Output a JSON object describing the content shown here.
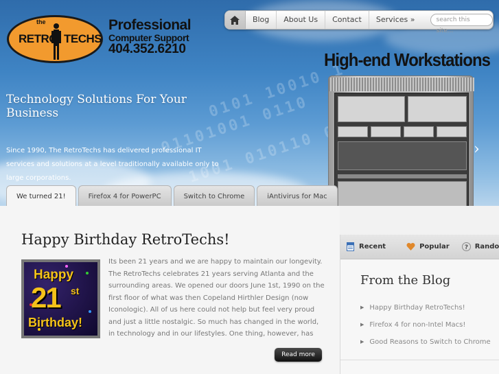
{
  "logo": {
    "the": "the",
    "retro": "RETRO",
    "techs": "TECHS",
    "line1": "Professional",
    "line2": "Computer Support",
    "phone": "404.352.6210"
  },
  "nav": {
    "home_icon": "home-icon",
    "items": [
      "Blog",
      "About Us",
      "Contact",
      "Services »"
    ],
    "search_placeholder": "search this site..."
  },
  "hero": {
    "title": "Technology Solutions For Your Business",
    "description": "Since 1990, The RetroTechs has delivered professional IT services and solutions at a level traditionally available only to large corporations.",
    "feature_title": "High-end Workstations",
    "next_icon": "chevron-right-icon"
  },
  "tabs": [
    {
      "label": "We turned 21!",
      "active": true
    },
    {
      "label": "Firefox 4 for PowerPC",
      "active": false
    },
    {
      "label": "Switch to Chrome",
      "active": false
    },
    {
      "label": "iAntivirus for Mac",
      "active": false
    }
  ],
  "post": {
    "title": "Happy Birthday RetroTechs!",
    "image_text": {
      "happy": "Happy",
      "num": "21",
      "st": "st",
      "birthday": "Birthday!"
    },
    "body": "Its been 21 years and we are happy to maintain our longevity. The RetroTechs celebrates 21 years serving Atlanta and the surrounding areas. We opened our doors June 1st, 1990 on the first floor of what was then Copeland Hirthler Design (now Iconologic). All of us here could not help but feel very proud and just a little nostalgic. So much has changed in the world, in technology and in our lifestyles. One thing, however, has remained the same:...",
    "read_more": "Read more"
  },
  "sidebar": {
    "tabs": [
      {
        "label": "Recent",
        "icon": "document-icon",
        "color": "#3a6fb6"
      },
      {
        "label": "Popular",
        "icon": "heart-icon",
        "color": "#e0882b"
      },
      {
        "label": "Random",
        "icon": "question-icon",
        "color": "#8a8a8a"
      }
    ],
    "heading": "From the Blog",
    "items": [
      "Happy Birthday RetroTechs!",
      "Firefox 4 for non-Intel Macs!",
      "Good Reasons to Switch to Chrome"
    ]
  },
  "colors": {
    "accent_orange": "#f29a2e",
    "sky_blue": "#3f84c4",
    "button_dark": "#222222"
  }
}
